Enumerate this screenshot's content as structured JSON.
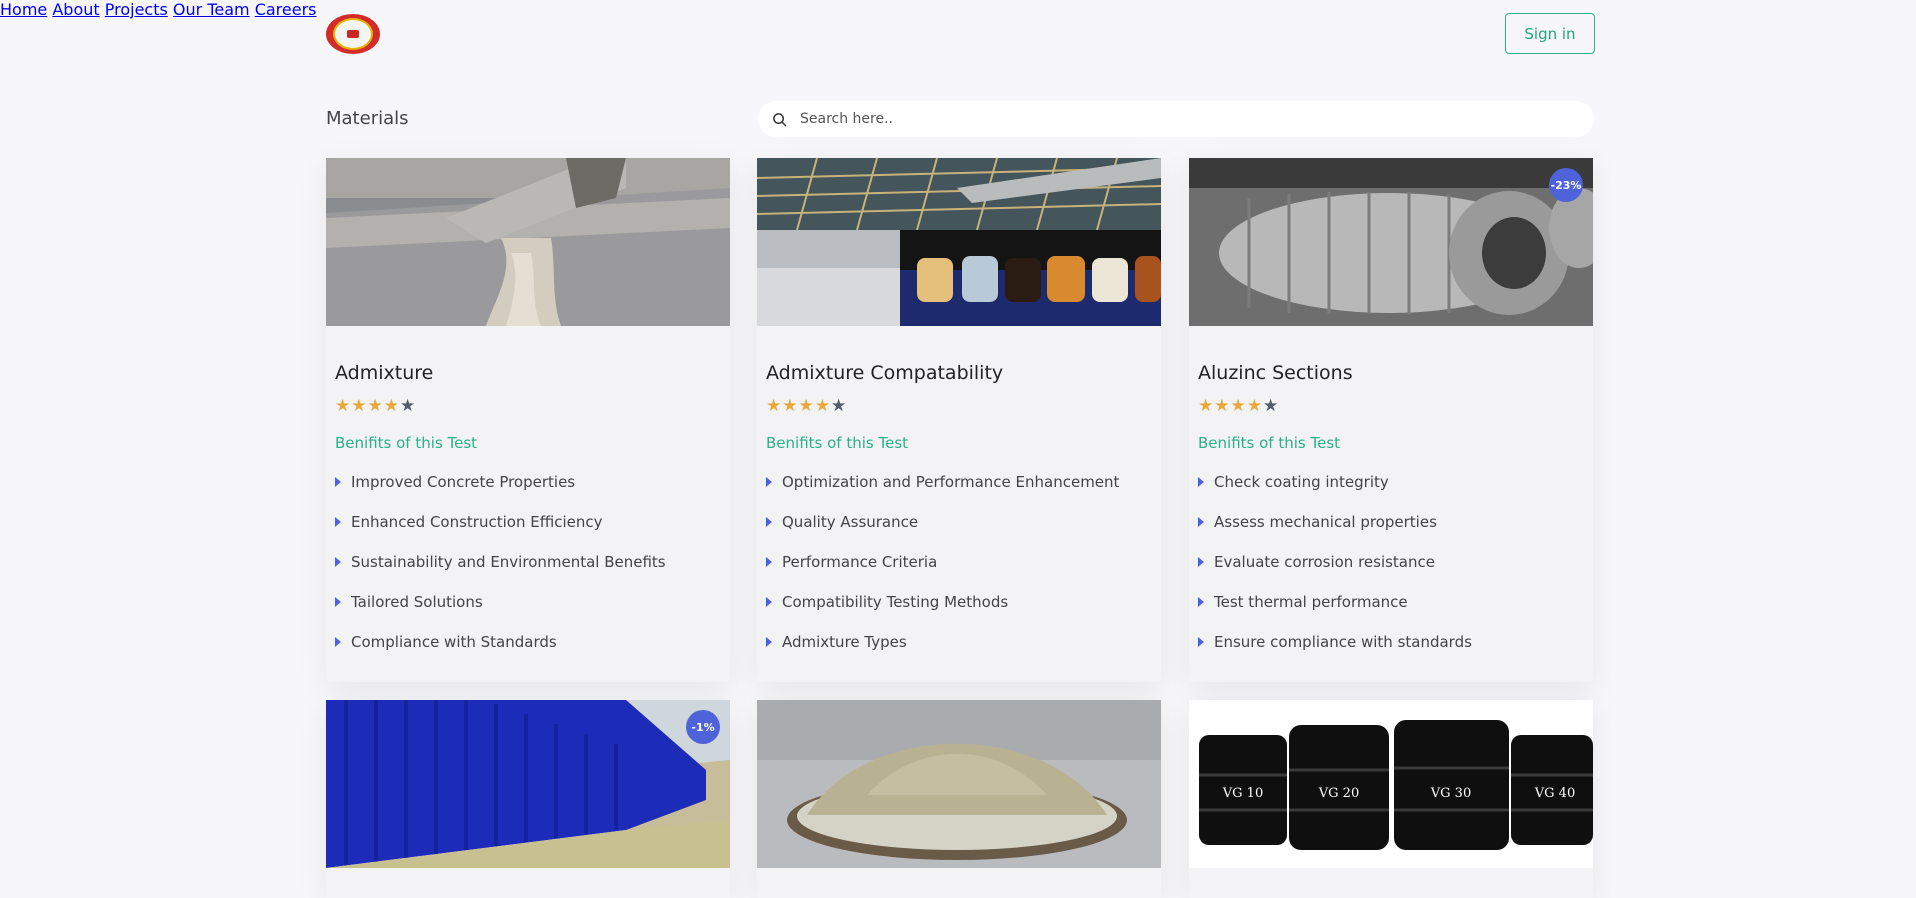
{
  "header": {
    "nav": [
      "Home",
      "About",
      "Projects",
      "Our Team",
      "Careers"
    ],
    "signin_label": "Sign in"
  },
  "main": {
    "section_title": "Materials",
    "search_placeholder": "Search here..",
    "benefits_label": "Benifits of this Test",
    "cards": [
      {
        "title": "Admixture",
        "rating": 4,
        "badge": "",
        "items": [
          "Improved Concrete Properties",
          "Enhanced Construction Efficiency",
          "Sustainability and Environmental Benefits",
          "Tailored Solutions",
          "Compliance with Standards"
        ]
      },
      {
        "title": "Admixture Compatability",
        "rating": 4,
        "badge": "",
        "items": [
          "Optimization and Performance Enhancement",
          "Quality Assurance",
          "Performance Criteria",
          "Compatibility Testing Methods",
          "Admixture Types"
        ]
      },
      {
        "title": "Aluzinc Sections",
        "rating": 4,
        "badge": "-23%",
        "items": [
          "Check coating integrity",
          "Assess mechanical properties",
          "Evaluate corrosion resistance",
          "Test thermal performance",
          "Ensure compliance with standards"
        ]
      },
      {
        "badge": "-1%"
      },
      {
        "badge": ""
      },
      {
        "badge": "",
        "drum_labels": [
          "VG 10",
          "VG 20",
          "VG 30",
          "VG 40"
        ]
      }
    ]
  },
  "colors": {
    "accent_green": "#2ab08a",
    "badge_blue": "#4e63d9",
    "star_gold": "#e8a83a"
  }
}
